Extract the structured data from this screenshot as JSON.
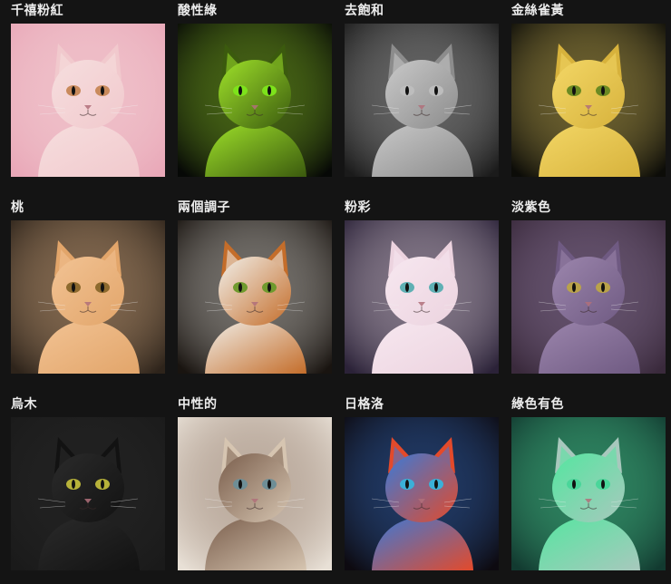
{
  "gallery": {
    "items": [
      {
        "label": "千禧粉紅",
        "bg": "#e9a8b8",
        "fur": "#f1c9cd",
        "eye": "#c98a5c",
        "accent": "#f6dede"
      },
      {
        "label": "酸性綠",
        "bg": "#060806",
        "fur": "#3b5a0e",
        "eye": "#7de31b",
        "accent": "#9fe22a"
      },
      {
        "label": "去飽和",
        "bg": "#1b1b1b",
        "fur": "#8c8c8c",
        "eye": "#bdbdbd",
        "accent": "#c9c9c9"
      },
      {
        "label": "金絲雀黃",
        "bg": "#0c0c08",
        "fur": "#d7b23c",
        "eye": "#6b8a22",
        "accent": "#f3d766"
      },
      {
        "label": "桃",
        "bg": "#2e241b",
        "fur": "#e2a56a",
        "eye": "#8d6a2e",
        "accent": "#f2c394"
      },
      {
        "label": "兩個調子",
        "bg": "#191410",
        "fur": "#c46d2a",
        "eye": "#6f9a2e",
        "accent": "#f1efe9"
      },
      {
        "label": "粉彩",
        "bg": "#2b2238",
        "fur": "#ecd3df",
        "eye": "#5fb0b4",
        "accent": "#f7e8f0"
      },
      {
        "label": "淡紫色",
        "bg": "#3a2a3c",
        "fur": "#6f5a82",
        "eye": "#b9a24a",
        "accent": "#9c86ad"
      },
      {
        "label": "烏木",
        "bg": "#1a1a1a",
        "fur": "#121212",
        "eye": "#b7b23a",
        "accent": "#2b2b2b"
      },
      {
        "label": "中性的",
        "bg": "#e8e0d6",
        "fur": "#d6c5b1",
        "eye": "#6e8e96",
        "accent": "#7a5e4c"
      },
      {
        "label": "日格洛",
        "bg": "#0d0a10",
        "fur": "#e34a2b",
        "eye": "#3bb0d8",
        "accent": "#3a7ad8"
      },
      {
        "label": "綠色有色",
        "bg": "#123a30",
        "fur": "#a8c8bd",
        "eye": "#4ad69a",
        "accent": "#54e6a0"
      }
    ]
  }
}
